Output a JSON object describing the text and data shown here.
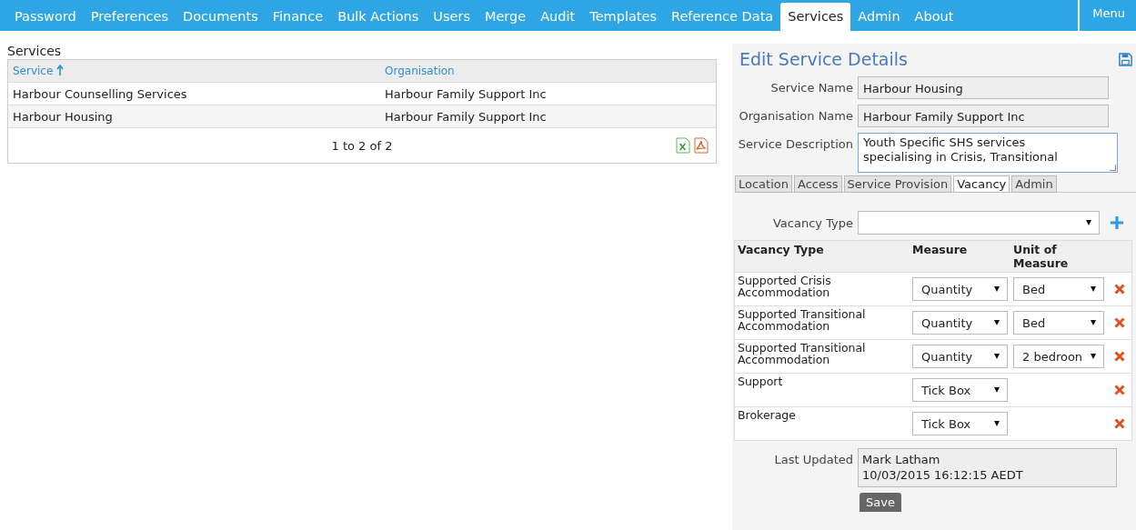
{
  "nav": {
    "items": [
      {
        "label": "Password",
        "selected": false
      },
      {
        "label": "Preferences",
        "selected": false
      },
      {
        "label": "Documents",
        "selected": false
      },
      {
        "label": "Finance",
        "selected": false
      },
      {
        "label": "Bulk Actions",
        "selected": false
      },
      {
        "label": "Users",
        "selected": false
      },
      {
        "label": "Merge",
        "selected": false
      },
      {
        "label": "Audit",
        "selected": false
      },
      {
        "label": "Templates",
        "selected": false
      },
      {
        "label": "Reference Data",
        "selected": false
      },
      {
        "label": "Services",
        "selected": true
      },
      {
        "label": "Admin",
        "selected": false
      },
      {
        "label": "About",
        "selected": false
      }
    ],
    "menu": "Menu"
  },
  "services": {
    "title": "Services",
    "columns": [
      {
        "label": "Service",
        "sorted": true
      },
      {
        "label": "Organisation",
        "sorted": false
      }
    ],
    "rows": [
      [
        "Harbour Counselling Services",
        "Harbour Family Support Inc"
      ],
      [
        "Harbour Housing",
        "Harbour Family Support Inc"
      ]
    ],
    "pager": "1 to 2 of 2"
  },
  "edit": {
    "title": "Edit Service Details",
    "fields": [
      {
        "label": "Service Name",
        "value": "Harbour Housing"
      },
      {
        "label": "Organisation Name",
        "value": "Harbour Family Support Inc"
      }
    ],
    "description": {
      "label": "Service Description",
      "lines": [
        "Youth Specific SHS services",
        "specialising in Crisis, Transitional"
      ]
    },
    "tabs": [
      {
        "label": "Location",
        "selected": false
      },
      {
        "label": "Access",
        "selected": false
      },
      {
        "label": "Service Provision",
        "selected": false
      },
      {
        "label": "Vacancy",
        "selected": true
      },
      {
        "label": "Admin",
        "selected": false
      }
    ],
    "vacancy_type_label": "Vacancy Type",
    "columns": [
      "Vacancy Type",
      "Measure",
      "Unit of Measure"
    ],
    "rows": [
      {
        "type": "Supported Crisis Accommodation",
        "measure": "Quantity",
        "unit": "Bed"
      },
      {
        "type": "Supported Transitional Accommodation",
        "measure": "Quantity",
        "unit": "Bed"
      },
      {
        "type": "Supported Transitional Accommodation",
        "measure": "Quantity",
        "unit": "2 bedroon"
      },
      {
        "type": "Support",
        "measure": "Tick Box"
      },
      {
        "type": "Brokerage",
        "measure": "Tick Box"
      }
    ],
    "last_updated": {
      "label": "Last Updated",
      "lines": [
        "Mark Latham",
        "10/03/2015 16:12:15 AEDT"
      ]
    },
    "save": "Save"
  }
}
